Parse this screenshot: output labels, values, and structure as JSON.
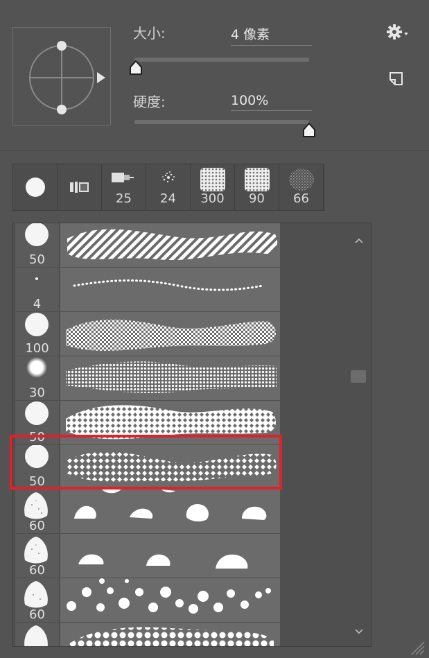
{
  "size": {
    "label": "大小:",
    "value": "4 像素",
    "level_percent": 0
  },
  "hardness": {
    "label": "硬度:",
    "value": "100%",
    "level_percent": 100
  },
  "icons": {
    "settings": "gear-icon",
    "new_preset": "new-preset-icon",
    "collapse": "chevron-up-icon",
    "expand": "chevron-down-icon"
  },
  "presets": [
    {
      "name": "round-brush",
      "num": ""
    },
    {
      "name": "chalk-brush",
      "num": ""
    },
    {
      "name": "pen-brush",
      "num": "25"
    },
    {
      "name": "spatter-brush",
      "num": "24"
    },
    {
      "name": "texture-brush",
      "num": "300"
    },
    {
      "name": "texture-brush-2",
      "num": "90"
    },
    {
      "name": "spray-brush",
      "num": "66"
    }
  ],
  "brushes": [
    {
      "num": "50"
    },
    {
      "num": "4"
    },
    {
      "num": "100"
    },
    {
      "num": "30"
    },
    {
      "num": "50"
    },
    {
      "num": "50"
    },
    {
      "num": "60"
    },
    {
      "num": "60"
    },
    {
      "num": "60"
    },
    {
      "num": ""
    }
  ],
  "colors": {
    "highlight": "#e3202a",
    "panel": "#535353"
  }
}
